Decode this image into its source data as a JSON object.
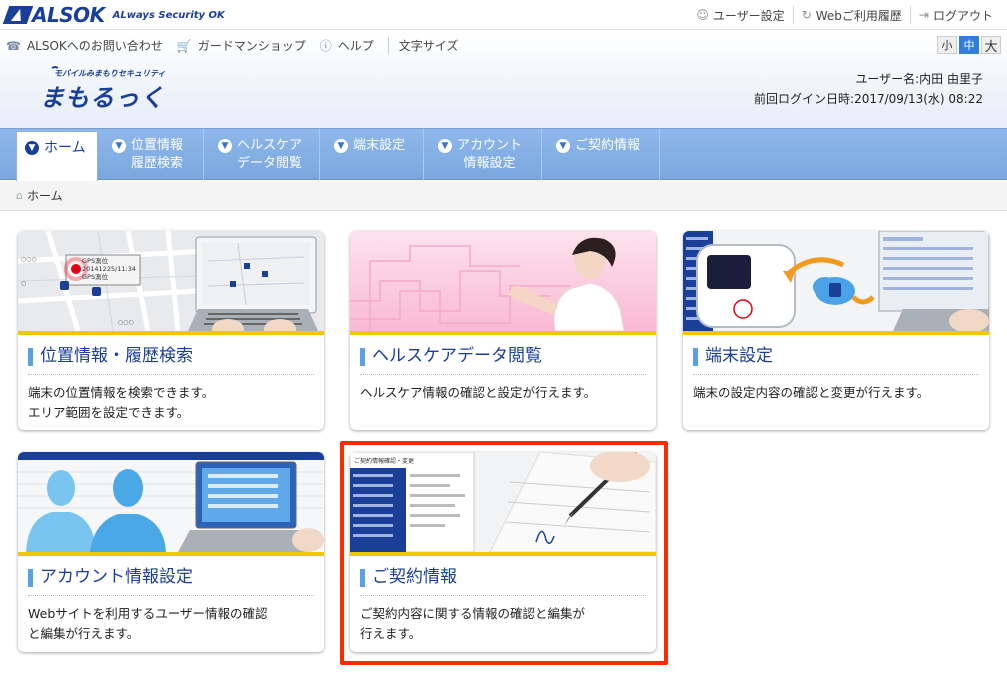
{
  "top": {
    "logo_text": "ALSOK",
    "logo_tagline": "ALways Security OK",
    "links": [
      {
        "label": "ユーザー設定",
        "icon": "user-icon"
      },
      {
        "label": "Webご利用履歴",
        "icon": "history-icon"
      },
      {
        "label": "ログアウト",
        "icon": "logout-icon"
      }
    ]
  },
  "subheader": {
    "links": [
      {
        "label": "ALSOKへのお問い合わせ",
        "icon": "phone-icon"
      },
      {
        "label": "ガードマンショップ",
        "icon": "cart-icon"
      },
      {
        "label": "ヘルプ",
        "icon": "help-icon"
      }
    ],
    "font_size_label": "文字サイズ",
    "font_sizes": [
      "小",
      "中",
      "大"
    ],
    "font_size_selected": "中",
    "brand_sub": "モバイルみまもりセキュリティ",
    "brand_main": "まもるっく",
    "user_line": "ユーザー名:内田 由里子",
    "login_line": "前回ログイン日時:2017/09/13(水) 08:22"
  },
  "nav": {
    "items": [
      {
        "label": "ホーム",
        "active": true
      },
      {
        "label": "位置情報\n履歴検索"
      },
      {
        "label": "ヘルスケア\nデータ閲覧"
      },
      {
        "label": "端末設定"
      },
      {
        "label": "アカウント\n情報設定"
      },
      {
        "label": "ご契約情報"
      }
    ]
  },
  "breadcrumb": {
    "home": "ホーム"
  },
  "cards": [
    {
      "title": "位置情報・履歴検索",
      "desc": "端末の位置情報を検索できます。\nエリア範囲を設定できます。",
      "map_text_1": "GPS測位",
      "map_text_2": "20141225/11:34",
      "map_text_3": "GPS測位"
    },
    {
      "title": "ヘルスケアデータ閲覧",
      "desc": "ヘルスケア情報の確認と設定が行えます。"
    },
    {
      "title": "端末設定",
      "desc": "端末の設定内容の確認と変更が行えます。"
    },
    {
      "title": "アカウント情報設定",
      "desc": "Webサイトを利用するユーザー情報の確認\nと編集が行えます。"
    },
    {
      "title": "ご契約情報",
      "desc": "ご契約内容に関する情報の確認と編集が\n行えます。",
      "doc_title": "ご契約情報確認・変更"
    }
  ],
  "colors": {
    "brand": "#1a3f98",
    "nav": "#8fb8ea",
    "accent_stripe": "#f0c800",
    "highlight": "#ff2a00"
  }
}
